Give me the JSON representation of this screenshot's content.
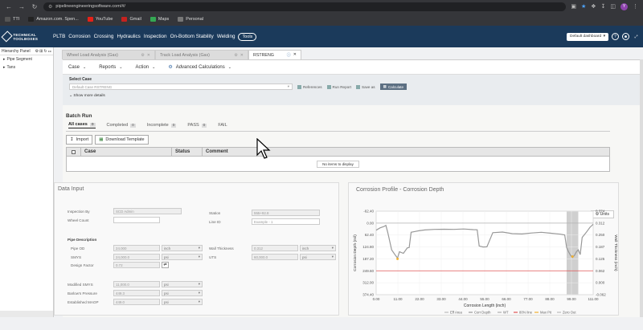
{
  "browser": {
    "url": "pipelineengineeringsoftware.com/#/",
    "avatar": "Y",
    "bookmarks": [
      {
        "label": "TTI",
        "color": "#555"
      },
      {
        "label": "Amazon.com. Spen...",
        "color": "#222"
      },
      {
        "label": "YouTube",
        "color": "#e62117"
      },
      {
        "label": "Gmail",
        "color": "#c5221f"
      },
      {
        "label": "Maps",
        "color": "#34a853"
      },
      {
        "label": "Personal",
        "color": "#777"
      }
    ]
  },
  "nav": {
    "logo": "TECHNICAL TOOLBOXES",
    "items": [
      "PLTB",
      "Corrosion",
      "Crossing",
      "Hydraulics",
      "Inspection",
      "On-Bottom Stability",
      "Welding"
    ],
    "tools": "Tools",
    "dashboard": "Default dashboard"
  },
  "hierarchy": {
    "title": "Hierarchy Panel",
    "items": [
      "Pipe Segment",
      "Tans"
    ]
  },
  "tabs": [
    {
      "label": "Wheel Load Analysis (Gas)"
    },
    {
      "label": "Track Load Analysis (Gas)"
    },
    {
      "label": "RSTRENG"
    }
  ],
  "toolbar": {
    "case": "Case",
    "reports": "Reports",
    "action": "Action",
    "advanced": "Advanced Calculations"
  },
  "select_case": {
    "label": "Select Case",
    "value": "Default Case RSTRENG",
    "references": "References",
    "run_report": "Run Report",
    "save_as": "Save as",
    "calculate": "Calculate",
    "show_more": "Show more details"
  },
  "batch": {
    "title": "Batch Run",
    "tabs": [
      {
        "label": "All cases",
        "count": "0"
      },
      {
        "label": "Completed",
        "count": "0"
      },
      {
        "label": "Incomplete",
        "count": "0"
      },
      {
        "label": "PASS",
        "count": "0"
      },
      {
        "label": "FAIL",
        "count": ""
      }
    ],
    "import": "Import",
    "download": "Download Template",
    "columns": [
      "Case",
      "Status",
      "Comment"
    ],
    "empty": "No items to display"
  },
  "data_input": {
    "title": "Data Input",
    "inspection_by": "Inspection By",
    "inspection_val": "SCD Admin",
    "wheel_count": "Wheel Count",
    "station": "Station",
    "station_val": "555+92.8",
    "line_id": "Line ID",
    "line_id_ph": "Example - 1",
    "pipe_desc": "Pipe Description",
    "pipe_od": "Pipe OD",
    "pipe_od_val": "24.000",
    "pipe_od_unit": "inch",
    "smys": "SMYS",
    "smys_val": "24,000.0",
    "smys_unit": "psi",
    "design_factor": "Design Factor",
    "design_factor_val": "0.72",
    "wall_thickness": "Wall Thickness",
    "wall_val": "0.312",
    "wall_unit": "inch",
    "uts": "UTS",
    "uts_val": "60,000.0",
    "uts_unit": "psi",
    "mod_smys": "Modified SMYS",
    "mod_smys_val": "11,000.0",
    "mod_smys_unit": "psi",
    "barlow": "Barlow's Pressure",
    "barlow_val": "449.3",
    "barlow_unit": "psi",
    "est_maop": "Established MAOP",
    "est_maop_val": "449.0",
    "est_maop_unit": "psi"
  },
  "chart_data": {
    "type": "line",
    "title": "Corrosion Profile - Corrosion Depth",
    "units_btn": "Units",
    "xlabel": "Corrosion Length (inch)",
    "ylabel": "Corrosion Depth (mil)",
    "y2label": "Wall Thickness (inch)",
    "xlim": [
      0,
      111.66
    ],
    "ylim": [
      -62.4,
      374.4
    ],
    "y2lim": [
      -0.062,
      0.374
    ],
    "xticks": [
      "0.00",
      "11.00",
      "22.00",
      "33.00",
      "44.00",
      "55.00",
      "66.00",
      "77.00",
      "88.00",
      "99.00",
      "111.00"
    ],
    "yticks": [
      "-62.40",
      "0.00",
      "62.40",
      "124.80",
      "187.20",
      "249.60",
      "312.00",
      "374.40"
    ],
    "y2ticks": [
      "0.374",
      "0.312",
      "0.250",
      "0.187",
      "0.125",
      "0.062",
      "0.000",
      "-0.062"
    ],
    "wt_line": 0,
    "pct80_line": 249.6,
    "shaded": [
      98,
      104
    ],
    "maxpit": [
      [
        11,
        187.2
      ],
      [
        101,
        174.7
      ]
    ],
    "series_x": [
      0,
      2,
      4,
      5,
      6,
      8,
      10,
      11,
      12,
      14,
      16,
      17,
      18,
      20,
      22,
      25,
      30,
      35,
      40,
      45,
      50,
      52,
      53,
      55,
      57,
      58,
      60,
      65,
      70,
      75,
      80,
      85,
      90,
      95,
      97,
      98,
      99,
      100,
      101,
      102,
      103,
      104,
      105,
      106,
      108,
      110,
      111.66
    ],
    "series_y": [
      37,
      25,
      18,
      12,
      50,
      140,
      170,
      183,
      150,
      158,
      130,
      128,
      48,
      44,
      40,
      36,
      33,
      32,
      33,
      31,
      34,
      35,
      120,
      125,
      124,
      100,
      50,
      47,
      55,
      57,
      52,
      48,
      53,
      58,
      62,
      128,
      150,
      168,
      180,
      170,
      150,
      140,
      165,
      75,
      50,
      22,
      6
    ],
    "legend": [
      "Eff Area",
      "Corr Depth",
      "WT",
      "80% line",
      "Max Pit",
      "Zero Out"
    ],
    "colors": {
      "series": "#999999",
      "wt": "#b0b0b0",
      "pct80": "#e05555",
      "maxpit": "#f0b030",
      "shade": "#cfcfcf"
    }
  }
}
